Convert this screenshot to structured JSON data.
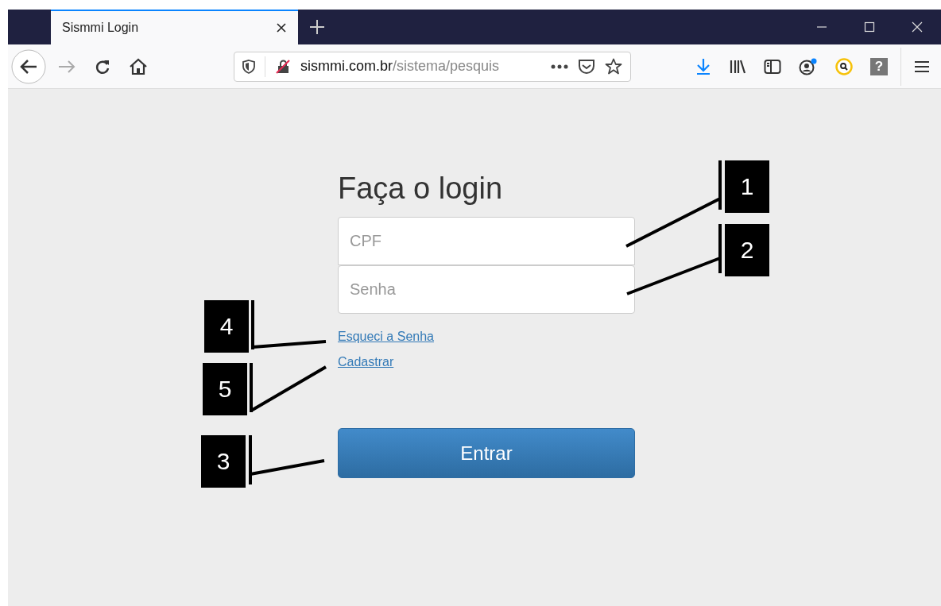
{
  "browser": {
    "tab": {
      "title": "Sismmi Login",
      "selected": true
    },
    "url": {
      "domain": "sismmi.com.br",
      "path": "/sistema/pesquis"
    },
    "help_glyph": "?"
  },
  "login": {
    "title": "Faça o login",
    "fields": [
      {
        "placeholder": "CPF"
      },
      {
        "placeholder": "Senha"
      }
    ],
    "links": [
      "Esqueci a Senha",
      "Cadastrar"
    ],
    "button": "Entrar"
  },
  "callouts": [
    {
      "label": "1"
    },
    {
      "label": "2"
    },
    {
      "label": "4"
    },
    {
      "label": "5"
    },
    {
      "label": "3"
    }
  ]
}
